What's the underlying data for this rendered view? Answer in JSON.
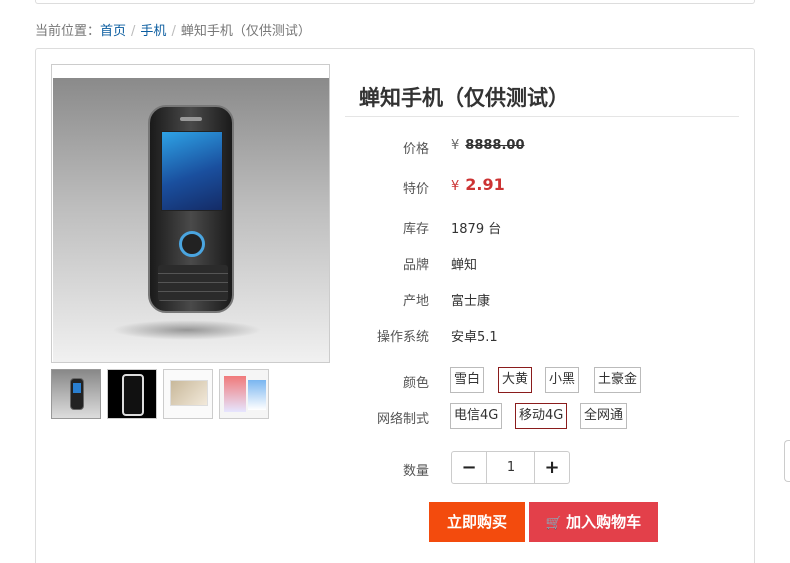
{
  "breadcrumb": {
    "prefix": "当前位置：",
    "items": [
      "首页",
      "手机"
    ],
    "separator": "/",
    "current": "蝉知手机（仅供测试）"
  },
  "product": {
    "title": "蝉知手机（仅供测试）",
    "price_label": "价格",
    "currency": "¥",
    "price": "8888.00",
    "sale_label": "特价",
    "sale_price": "2.91",
    "stock_label": "库存",
    "stock": "1879 台",
    "brand_label": "品牌",
    "brand": "蝉知",
    "origin_label": "产地",
    "origin": "富士康",
    "os_label": "操作系统",
    "os": "安卓5.1",
    "color_label": "颜色",
    "colors": [
      "雪白",
      "大黄",
      "小黑",
      "土豪金"
    ],
    "selected_color": "大黄",
    "network_label": "网络制式",
    "networks": [
      "电信4G",
      "移动4G",
      "全网通"
    ],
    "selected_network": "移动4G",
    "quantity_label": "数量",
    "quantity": "1"
  },
  "actions": {
    "buy_now": "立即购买",
    "add_to_cart": "加入购物车"
  },
  "colors": {
    "link": "#0b5da0",
    "sale": "#cc3333",
    "buy_button": "#f34b0d",
    "cart_button": "#e3404a",
    "selected_border": "#8a1c1c"
  }
}
